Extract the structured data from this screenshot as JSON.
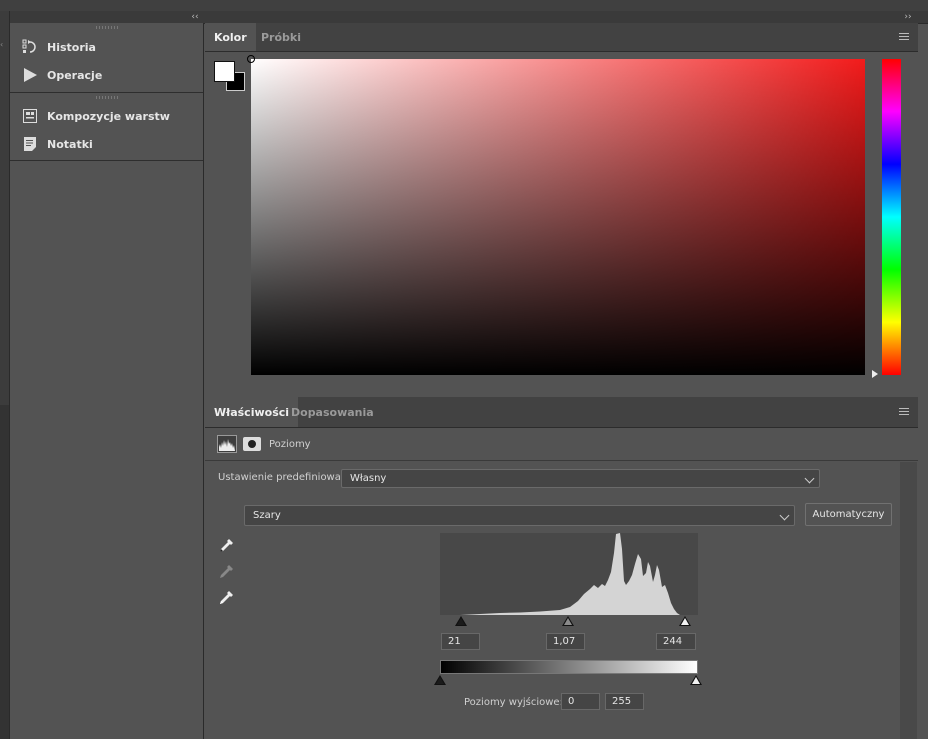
{
  "toolbar": {
    "collapse_left": "‹‹",
    "collapse_right": "››"
  },
  "dock": {
    "items": [
      {
        "label": "Historia",
        "icon": "history-icon"
      },
      {
        "label": "Operacje",
        "icon": "play-icon"
      },
      {
        "label": "Kompozycje warstw",
        "icon": "layer-comps-icon"
      },
      {
        "label": "Notatki",
        "icon": "notes-icon"
      }
    ]
  },
  "color_panel": {
    "tabs": [
      {
        "label": "Kolor",
        "active": true
      },
      {
        "label": "Próbki",
        "active": false
      }
    ],
    "foreground": "#ffffff",
    "background": "#000000",
    "hue_color": "#f21b1b"
  },
  "properties_panel": {
    "tabs": [
      {
        "label": "Właściwości",
        "active": true
      },
      {
        "label": "Dopasowania",
        "active": false
      }
    ],
    "adjustment_label": "Poziomy",
    "preset_label": "Ustawienie predefiniowane:",
    "preset_value": "Własny",
    "channel_value": "Szary",
    "auto_button": "Automatyczny",
    "input_levels": {
      "shadow": "21",
      "midtone": "1,07",
      "highlight": "244"
    },
    "output_label": "Poziomy wyjściowe:",
    "output_levels": {
      "low": "0",
      "high": "255"
    }
  },
  "colors": {
    "panel_bg": "#535353",
    "header_bg": "#424242",
    "histogram": "#d4d4d4"
  }
}
